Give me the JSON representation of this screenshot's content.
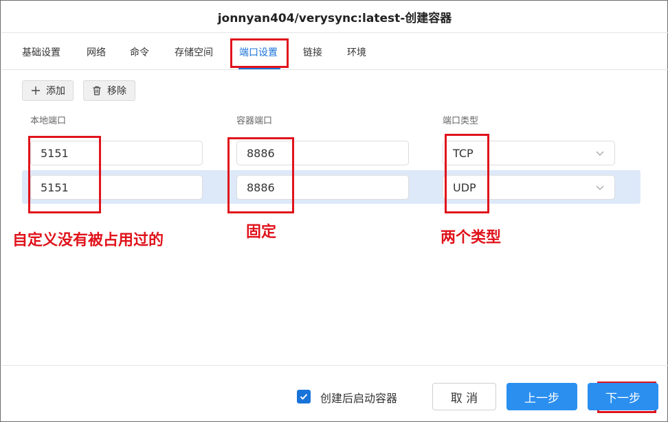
{
  "dialog": {
    "title": "jonnyan404/verysync:latest-创建容器"
  },
  "tabs": [
    {
      "label": "基础设置"
    },
    {
      "label": "网络"
    },
    {
      "label": "命令"
    },
    {
      "label": "存储空间"
    },
    {
      "label": "端口设置",
      "active": true
    },
    {
      "label": "链接"
    },
    {
      "label": "环境"
    }
  ],
  "toolbar": {
    "add_label": "添加",
    "remove_label": "移除"
  },
  "table": {
    "columns": [
      "本地端口",
      "容器端口",
      "端口类型"
    ],
    "rows": [
      {
        "local_port": "5151",
        "container_port": "8886",
        "type": "TCP"
      },
      {
        "local_port": "5151",
        "container_port": "8886",
        "type": "UDP"
      }
    ]
  },
  "annotations": {
    "local_port_note": "自定义没有被占用过的",
    "container_port_note": "固定",
    "type_note": "两个类型"
  },
  "footer": {
    "autostart_label": "创建后启动容器",
    "autostart_checked": true,
    "cancel_label": "取 消",
    "prev_label": "上一步",
    "next_label": "下一步"
  },
  "colors": {
    "accent": "#1a73d9",
    "primary_button": "#2b8ff0",
    "selected_row": "#dde9f9",
    "annotation_red": "#e0121b"
  }
}
